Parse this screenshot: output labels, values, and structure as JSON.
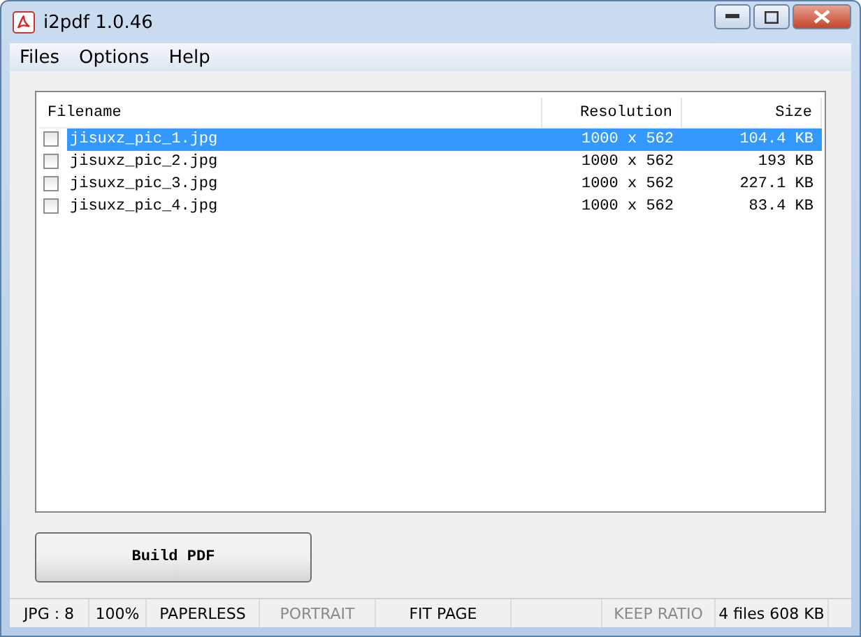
{
  "window": {
    "title": "i2pdf 1.0.46"
  },
  "menu": [
    "Files",
    "Options",
    "Help"
  ],
  "table": {
    "columns": [
      "Filename",
      "Resolution",
      "Size"
    ],
    "rows": [
      {
        "selected": true,
        "checked": false,
        "cells": [
          "jisuxz_pic_1.jpg",
          "1000 x 562",
          "104.4 KB"
        ]
      },
      {
        "selected": false,
        "checked": false,
        "cells": [
          "jisuxz_pic_2.jpg",
          "1000 x 562",
          "193 KB"
        ]
      },
      {
        "selected": false,
        "checked": false,
        "cells": [
          "jisuxz_pic_3.jpg",
          "1000 x 562",
          "227.1 KB"
        ]
      },
      {
        "selected": false,
        "checked": false,
        "cells": [
          "jisuxz_pic_4.jpg",
          "1000 x 562",
          "83.4 KB"
        ]
      }
    ]
  },
  "build_button": "Build PDF",
  "status_bar": [
    {
      "kind": "label",
      "text": "JPG : 8",
      "disabled": false
    },
    {
      "kind": "label",
      "text": "100%",
      "disabled": false
    },
    {
      "kind": "label",
      "text": "PAPERLESS",
      "disabled": false
    },
    {
      "kind": "label",
      "text": "PORTRAIT",
      "disabled": true
    },
    {
      "kind": "label",
      "text": "FIT PAGE",
      "disabled": false
    },
    {
      "kind": "blank"
    },
    {
      "kind": "label",
      "text": "KEEP RATIO",
      "disabled": true
    },
    {
      "kind": "label",
      "text": "4 files 608 KB",
      "disabled": false
    }
  ]
}
